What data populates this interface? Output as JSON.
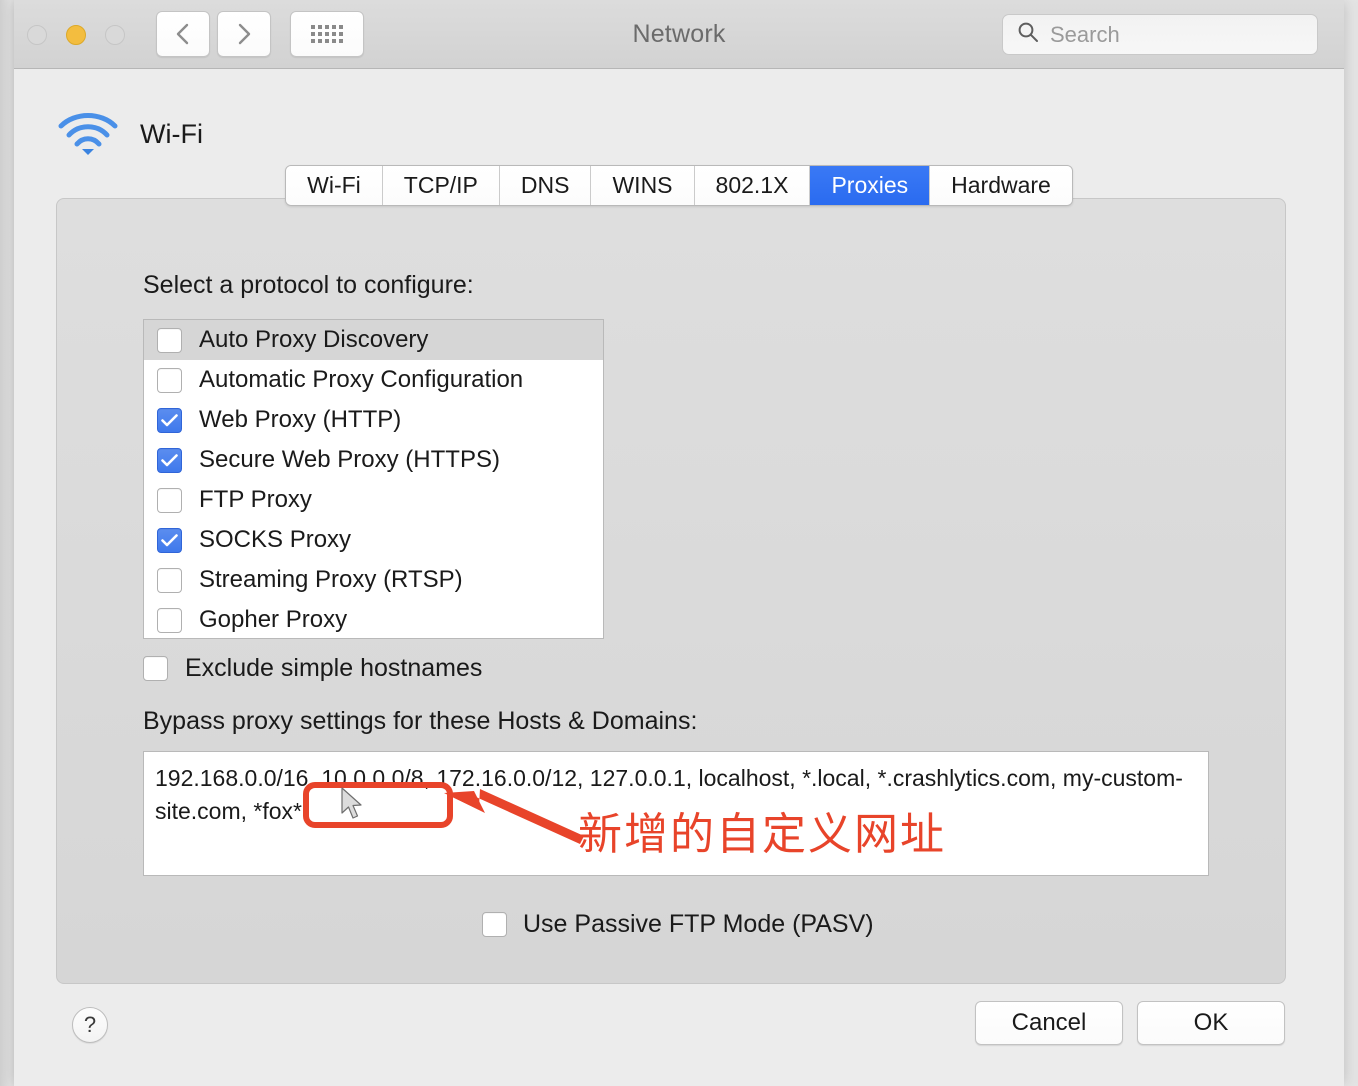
{
  "window": {
    "title": "Network",
    "traffic_lights": [
      "close",
      "minimize",
      "zoom"
    ],
    "nav": {
      "back_icon": "chevron-left-icon",
      "forward_icon": "chevron-right-icon",
      "grid_icon": "grid-dots-icon"
    },
    "search": {
      "placeholder": "Search",
      "value": "",
      "icon": "search-icon"
    }
  },
  "service": {
    "icon": "wifi-icon",
    "name": "Wi-Fi"
  },
  "tabs": [
    {
      "label": "Wi-Fi",
      "selected": false
    },
    {
      "label": "TCP/IP",
      "selected": false
    },
    {
      "label": "DNS",
      "selected": false
    },
    {
      "label": "WINS",
      "selected": false
    },
    {
      "label": "802.1X",
      "selected": false
    },
    {
      "label": "Proxies",
      "selected": true
    },
    {
      "label": "Hardware",
      "selected": false
    }
  ],
  "proxies": {
    "section_label": "Select a protocol to configure:",
    "protocols": [
      {
        "label": "Auto Proxy Discovery",
        "checked": false,
        "row_selected": true
      },
      {
        "label": "Automatic Proxy Configuration",
        "checked": false,
        "row_selected": false
      },
      {
        "label": "Web Proxy (HTTP)",
        "checked": true,
        "row_selected": false
      },
      {
        "label": "Secure Web Proxy (HTTPS)",
        "checked": true,
        "row_selected": false
      },
      {
        "label": "FTP Proxy",
        "checked": false,
        "row_selected": false
      },
      {
        "label": "SOCKS Proxy",
        "checked": true,
        "row_selected": false
      },
      {
        "label": "Streaming Proxy (RTSP)",
        "checked": false,
        "row_selected": false
      },
      {
        "label": "Gopher Proxy",
        "checked": false,
        "row_selected": false
      }
    ],
    "exclude_simple_hostnames": {
      "label": "Exclude simple hostnames",
      "checked": false
    },
    "bypass_label": "Bypass proxy settings for these Hosts & Domains:",
    "bypass_value": "192.168.0.0/16, 10.0.0.0/8, 172.16.0.0/12, 127.0.0.1, localhost, *.local, *.crashlytics.com, my-custom-site.com, *fox*",
    "passive_ftp": {
      "label": "Use Passive FTP Mode (PASV)",
      "checked": false
    }
  },
  "footer": {
    "help_label": "?",
    "cancel_label": "Cancel",
    "ok_label": "OK"
  },
  "annotation": {
    "text": "新增的自定义网址",
    "color": "#e8442a",
    "arrow_icon": "arrow-left-icon",
    "highlight_icon": "highlight-rect"
  },
  "cursor": {
    "icon": "mouse-pointer-icon"
  },
  "colors": {
    "accent_blue": "#3a79f5",
    "window_bg": "#ececec",
    "panel_bg": "#d8d8d8",
    "annotation_orange": "#e8442a"
  }
}
